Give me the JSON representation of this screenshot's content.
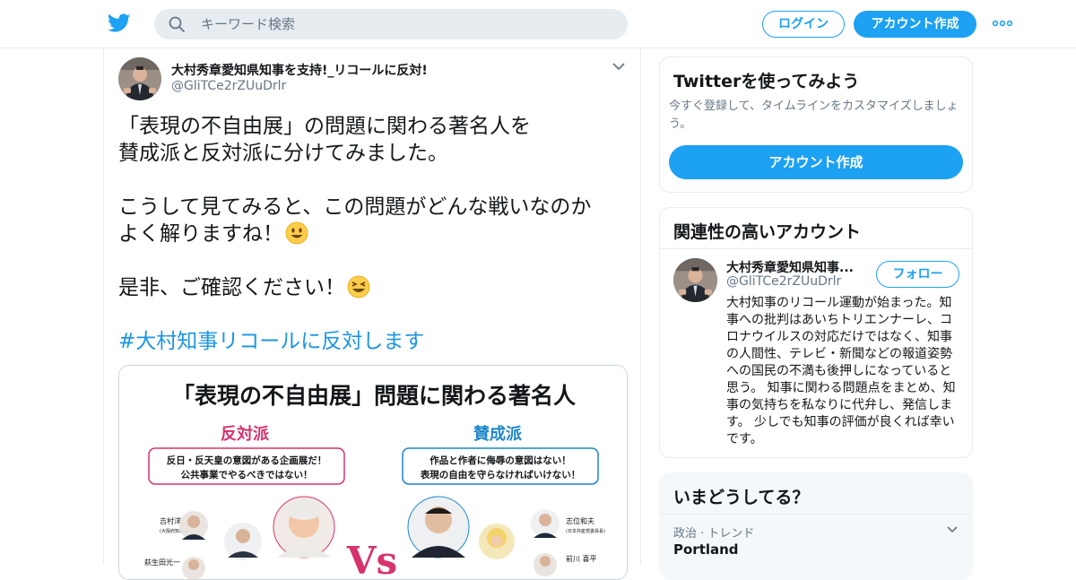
{
  "header": {
    "search_placeholder": "キーワード検索",
    "login_label": "ログイン",
    "signup_label": "アカウント作成"
  },
  "tweet": {
    "author_name": "大村秀章愛知県知事を支持!_リコールに反対!",
    "author_handle": "@GliTCe2rZUuDrlr",
    "lines": [
      "「表現の不自由展」の問題に関わる著名人を",
      "賛成派と反対派に分けてみました。",
      "こうして見てみると、この問題がどんな戦いなのか",
      "よく解りますね！",
      "是非、ご確認ください！"
    ],
    "hashtag": "#大村知事リコールに反対します",
    "image": {
      "title": "「表現の不自由展」問題に関わる著名人",
      "left_heading": "反対派",
      "left_box_line1": "反日・反天皇の意図がある企画展だ！",
      "left_box_line2": "公共事業でやるべきではない！",
      "right_heading": "賛成派",
      "right_box_line1": "作品と作者に侮辱の意図はない！",
      "right_box_line2": "表現の自由を守らなければいけない！",
      "vs": "Vs",
      "left_names": [
        "吉村洋文",
        "(大阪府知事)",
        "萩生田光一"
      ],
      "right_names": [
        "志位和夫",
        "(日本共産党委員長)",
        "前川 喜平"
      ]
    }
  },
  "signup_card": {
    "title": "Twitterを使ってみよう",
    "subtitle": "今すぐ登録して、タイムラインをカスタマイズしましょう。",
    "button_label": "アカウント作成"
  },
  "related_card": {
    "title": "関連性の高いアカウント",
    "name": "大村秀章愛知県知事...",
    "handle": "@GliTCe2rZUuDrlr",
    "follow_label": "フォロー",
    "bio": "大村知事のリコール運動が始まった。知事への批判はあいちトリエンナーレ、コロナウイルスの対応だけではなく、知事の人間性、テレビ・新聞などの報道姿勢への国民の不満も後押しになっていると思う。 知事に関わる問題点をまとめ、知事の気持ちを私なりに代弁し、発信します。 少しでも知事の評価が良くれば幸いです。"
  },
  "trends_card": {
    "title": "いまどうしてる？",
    "context": "政治 · トレンド",
    "trend": "Portland"
  },
  "colors": {
    "accent": "#1da1f2",
    "hashtag": "#1b95e0",
    "secondary_text": "#657786",
    "border": "#e6ecf0",
    "oppose": "#d6336c",
    "support": "#1c86c8"
  }
}
